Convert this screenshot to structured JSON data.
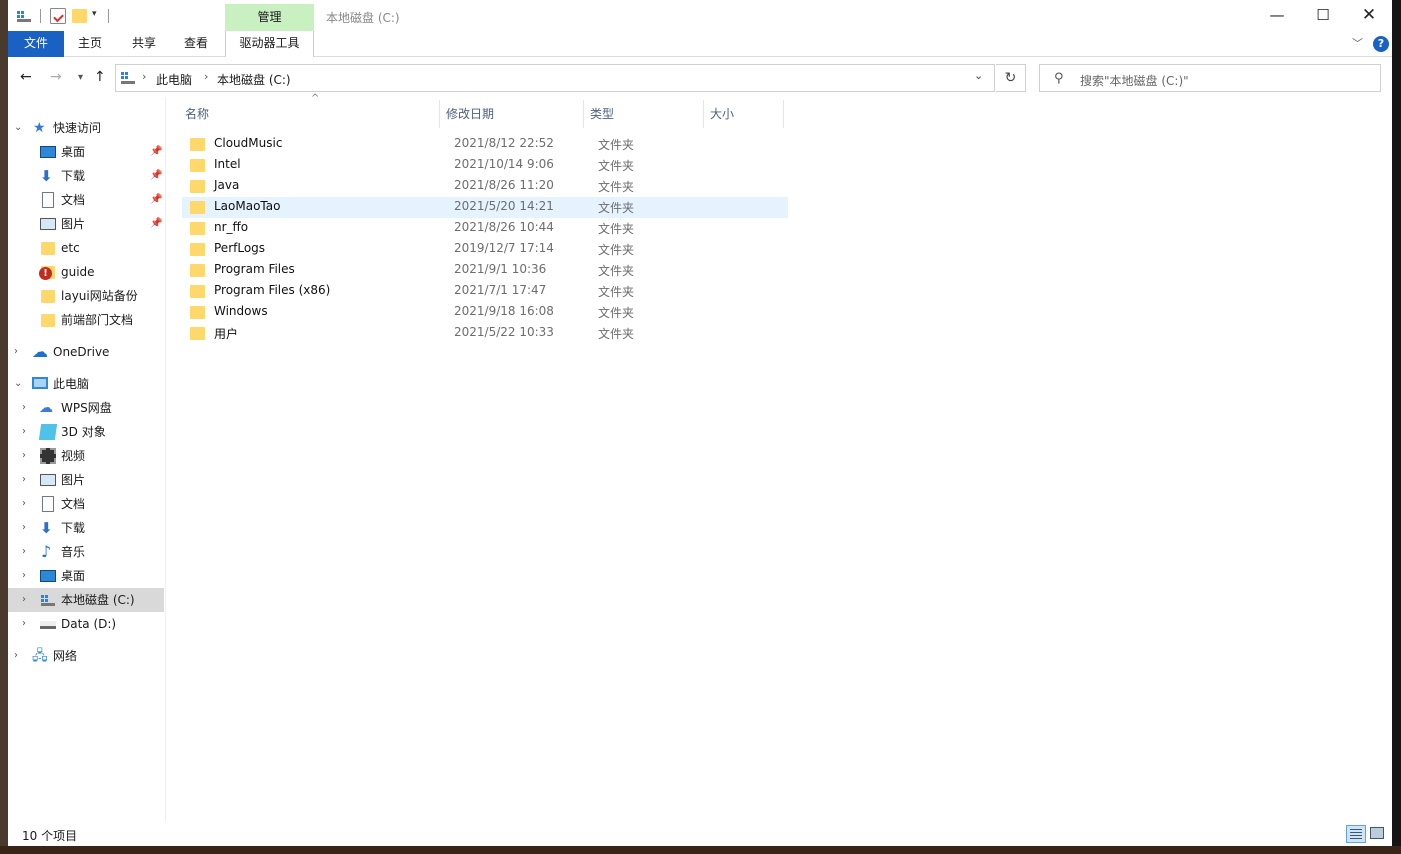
{
  "window": {
    "title": "本地磁盘 (C:)",
    "contextual_tab": "管理",
    "controls": {
      "minimize": "—",
      "maximize": "☐",
      "close": "✕"
    }
  },
  "ribbon": {
    "tabs": [
      "文件",
      "主页",
      "共享",
      "查看",
      "驱动器工具"
    ],
    "help": "?"
  },
  "address": {
    "breadcrumbs": [
      "此电脑",
      "本地磁盘 (C:)"
    ],
    "search_placeholder": "搜索\"本地磁盘 (C:)\""
  },
  "nav_pane": {
    "quick_access": "快速访问",
    "quick_items": [
      {
        "label": "桌面",
        "icon": "desktop-icon",
        "pinned": true
      },
      {
        "label": "下载",
        "icon": "download-icon",
        "pinned": true
      },
      {
        "label": "文档",
        "icon": "document-icon",
        "pinned": true
      },
      {
        "label": "图片",
        "icon": "picture-icon",
        "pinned": true
      },
      {
        "label": "etc",
        "icon": "folder-icon",
        "pinned": false
      },
      {
        "label": "guide",
        "icon": "warning-folder-icon",
        "pinned": false
      },
      {
        "label": "layui网站备份",
        "icon": "folder-icon",
        "pinned": false
      },
      {
        "label": "前端部门文档",
        "icon": "folder-icon",
        "pinned": false
      }
    ],
    "onedrive": "OneDrive",
    "this_pc": "此电脑",
    "pc_items": [
      {
        "label": "WPS网盘",
        "icon": "wps-cloud-icon"
      },
      {
        "label": "3D 对象",
        "icon": "3d-objects-icon"
      },
      {
        "label": "视频",
        "icon": "video-icon"
      },
      {
        "label": "图片",
        "icon": "picture-icon"
      },
      {
        "label": "文档",
        "icon": "document-icon"
      },
      {
        "label": "下载",
        "icon": "download-icon"
      },
      {
        "label": "音乐",
        "icon": "music-icon"
      },
      {
        "label": "桌面",
        "icon": "desktop-icon"
      },
      {
        "label": "本地磁盘 (C:)",
        "icon": "system-drive-icon",
        "selected": true
      },
      {
        "label": "Data (D:)",
        "icon": "drive-icon"
      }
    ],
    "network": "网络"
  },
  "file_list": {
    "columns": {
      "name": "名称",
      "modified": "修改日期",
      "type": "类型",
      "size": "大小"
    },
    "rows": [
      {
        "name": "CloudMusic",
        "date": "2021/8/12 22:52",
        "type": "文件夹"
      },
      {
        "name": "Intel",
        "date": "2021/10/14 9:06",
        "type": "文件夹"
      },
      {
        "name": "Java",
        "date": "2021/8/26 11:20",
        "type": "文件夹"
      },
      {
        "name": "LaoMaoTao",
        "date": "2021/5/20 14:21",
        "type": "文件夹",
        "hover": true
      },
      {
        "name": "nr_ffo",
        "date": "2021/8/26 10:44",
        "type": "文件夹"
      },
      {
        "name": "PerfLogs",
        "date": "2019/12/7 17:14",
        "type": "文件夹"
      },
      {
        "name": "Program Files",
        "date": "2021/9/1 10:36",
        "type": "文件夹"
      },
      {
        "name": "Program Files (x86)",
        "date": "2021/7/1 17:47",
        "type": "文件夹"
      },
      {
        "name": "Windows",
        "date": "2021/9/18 16:08",
        "type": "文件夹"
      },
      {
        "name": "用户",
        "date": "2021/5/22 10:33",
        "type": "文件夹"
      }
    ]
  },
  "status": {
    "item_count": "10 个项目"
  },
  "colors": {
    "accent": "#1961c2",
    "manage_tab": "#c9f0c0",
    "folder": "#ffd86b",
    "hover_row": "#e5f3ff"
  }
}
